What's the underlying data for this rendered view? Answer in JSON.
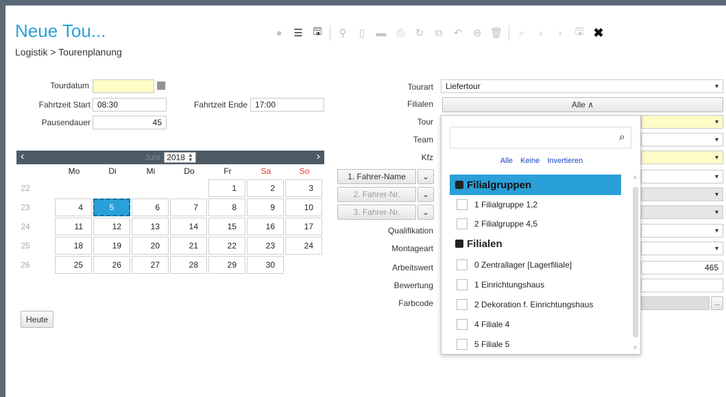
{
  "header": {
    "title": "Neue Tou...",
    "breadcrumb": "Logistik > Tourenplanung"
  },
  "toolbar": {
    "icons": [
      "chat-icon",
      "list-icon",
      "save-export-icon",
      "pin-icon",
      "new-doc-icon",
      "folder-icon",
      "print-icon",
      "refresh-icon",
      "copy-icon",
      "undo-icon",
      "delete-circle-icon",
      "trash-icon",
      "search-icon",
      "prev-icon",
      "next-icon",
      "save-icon",
      "close-icon"
    ],
    "glyphs": [
      "●",
      "☰",
      "🖫",
      "⚲",
      "▯",
      "▬",
      "⎙",
      "↻",
      "⧉",
      "↶",
      "⊖",
      "🗑",
      "⌕",
      "‹",
      "›",
      "🖫",
      "✖"
    ]
  },
  "left": {
    "tourdatum_label": "Tourdatum",
    "tourdatum_value": "",
    "fahrzeit_start_label": "Fahrtzeit Start",
    "fahrzeit_start_value": "08:30",
    "fahrzeit_ende_label": "Fahrtzeit Ende",
    "fahrzeit_ende_value": "17:00",
    "pausendauer_label": "Pausendauer",
    "pausendauer_value": "45",
    "heute_button": "Heute"
  },
  "calendar": {
    "month": "Juni",
    "year": "2018",
    "prev": "‹",
    "next": "›",
    "weekdays": [
      "Mo",
      "Di",
      "Mi",
      "Do",
      "Fr",
      "Sa",
      "So"
    ],
    "weekend_color": "#e0322c",
    "weeks": [
      "22",
      "23",
      "24",
      "25",
      "26"
    ],
    "rows": [
      [
        "",
        "",
        "",
        "",
        "1",
        "2",
        "3"
      ],
      [
        "4",
        "5",
        "6",
        "7",
        "8",
        "9",
        "10"
      ],
      [
        "11",
        "12",
        "13",
        "14",
        "15",
        "16",
        "17"
      ],
      [
        "18",
        "19",
        "20",
        "21",
        "22",
        "23",
        "24"
      ],
      [
        "25",
        "26",
        "27",
        "28",
        "29",
        "30",
        ""
      ]
    ],
    "selected_day": "5"
  },
  "right": {
    "tourart_label": "Tourart",
    "tourart_value": "Liefertour",
    "filialen_label": "Filialen",
    "filialen_value": "Alle ∧",
    "tour_label": "Tour",
    "team_label": "Team",
    "kfz_label": "Kfz",
    "fahrer1": "1. Fahrer-Name",
    "fahrer2": "2. Fahrer-Nr.",
    "fahrer3": "3. Fahrer-Nr.",
    "qualifikation_label": "Qualifikation",
    "montageart_label": "Montageart",
    "arbeitswert_label": "Arbeitswert",
    "arbeitswert_value": "465",
    "bewertung_label": "Bewertung",
    "farbcode_label": "Farbcode",
    "ellipsis": "..."
  },
  "dropdown": {
    "search_placeholder": "",
    "link_all": "Alle",
    "link_none": "Keine",
    "link_invert": "Invertieren",
    "group1": "Filialgruppen",
    "group1_items": [
      "1 Filialgruppe 1,2",
      "2 Filialgruppe 4,5"
    ],
    "group2": "Filialen",
    "group2_items": [
      "0 Zentrallager [Lagerfiliale]",
      "1 Einrichtungshaus",
      "2 Dekoration f. Einrichtungshaus",
      "4 Filiale 4",
      "5 Filiale 5"
    ]
  },
  "colors": {
    "accent": "#2aa0d8",
    "frame": "#5a6a76",
    "required": "#fffcc8"
  }
}
